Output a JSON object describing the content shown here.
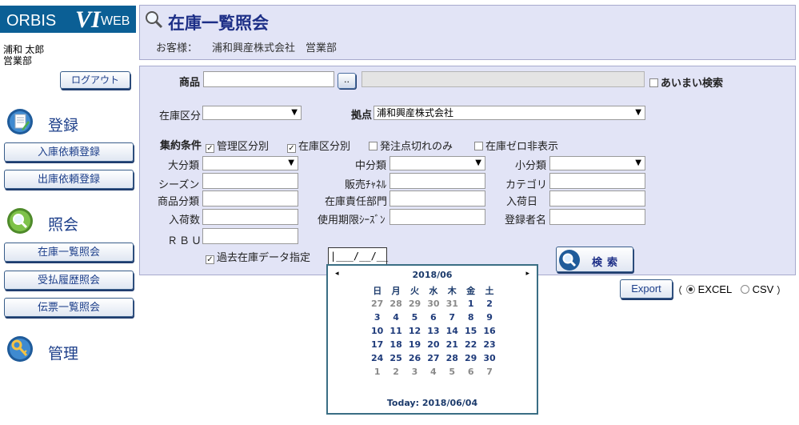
{
  "sidebar": {
    "logo": {
      "orbis": "ORBIS",
      "vi": "VI",
      "web": "WEB"
    },
    "user_name": "浦和 太郎",
    "department": "営業部",
    "logout_label": "ログアウト",
    "sections": [
      {
        "title": "登録",
        "icon": "register-icon",
        "items": [
          "入庫依頼登録",
          "出庫依頼登録"
        ]
      },
      {
        "title": "照会",
        "icon": "search-icon",
        "items": [
          "在庫一覧照会",
          "受払履歴照会",
          "伝票一覧照会"
        ]
      },
      {
        "title": "管理",
        "icon": "key-icon",
        "items": []
      }
    ]
  },
  "header": {
    "title": "在庫一覧照会",
    "customer_label": "お客様：",
    "customer_value": "浦和興産株式会社　営業部"
  },
  "form": {
    "product_label": "商品",
    "product_button": "..",
    "fuzzy_label": "あいまい検索",
    "stock_type_label": "在庫区分",
    "base_label": "拠点",
    "base_value": "浦和興産株式会社",
    "aggregate_label": "集約条件",
    "checks": [
      {
        "label": "管理区分別",
        "checked": true
      },
      {
        "label": "在庫区分別",
        "checked": true
      },
      {
        "label": "発注点切れのみ",
        "checked": false
      },
      {
        "label": "在庫ゼロ非表示",
        "checked": false
      }
    ],
    "large_cat_label": "大分類",
    "mid_cat_label": "中分類",
    "small_cat_label": "小分類",
    "season_label": "シーズン",
    "channel_label": "販売ﾁｬﾈﾙ",
    "category_label": "カテゴリ",
    "product_class_label": "商品分類",
    "resp_dept_label": "在庫責任部門",
    "arrival_date_label": "入荷日",
    "arrival_qty_label": "入荷数",
    "expiry_season_label": "使用期限ｼｰｽﾞﾝ",
    "registrant_label": "登録者名",
    "rbu_label": "ＲＢＵ",
    "past_data_label": "過去在庫データ指定",
    "date_value": "|___/__/__",
    "search_label": "検索"
  },
  "export": {
    "button_label": "Export",
    "open_paren": "（",
    "excel_label": "EXCEL",
    "csv_label": "CSV",
    "close_paren": "）",
    "selected": "EXCEL"
  },
  "calendar": {
    "month_label": "2018/06",
    "prev_symbol": "◂",
    "next_symbol": "▸",
    "weekdays": [
      "日",
      "月",
      "火",
      "水",
      "木",
      "金",
      "土"
    ],
    "weeks": [
      [
        "27",
        "28",
        "29",
        "30",
        "31",
        "1",
        "2"
      ],
      [
        "3",
        "4",
        "5",
        "6",
        "7",
        "8",
        "9"
      ],
      [
        "10",
        "11",
        "12",
        "13",
        "14",
        "15",
        "16"
      ],
      [
        "17",
        "18",
        "19",
        "20",
        "21",
        "22",
        "23"
      ],
      [
        "24",
        "25",
        "26",
        "27",
        "28",
        "29",
        "30"
      ],
      [
        "1",
        "2",
        "3",
        "4",
        "5",
        "6",
        "7"
      ]
    ],
    "today_label": "Today: 2018/06/04"
  }
}
